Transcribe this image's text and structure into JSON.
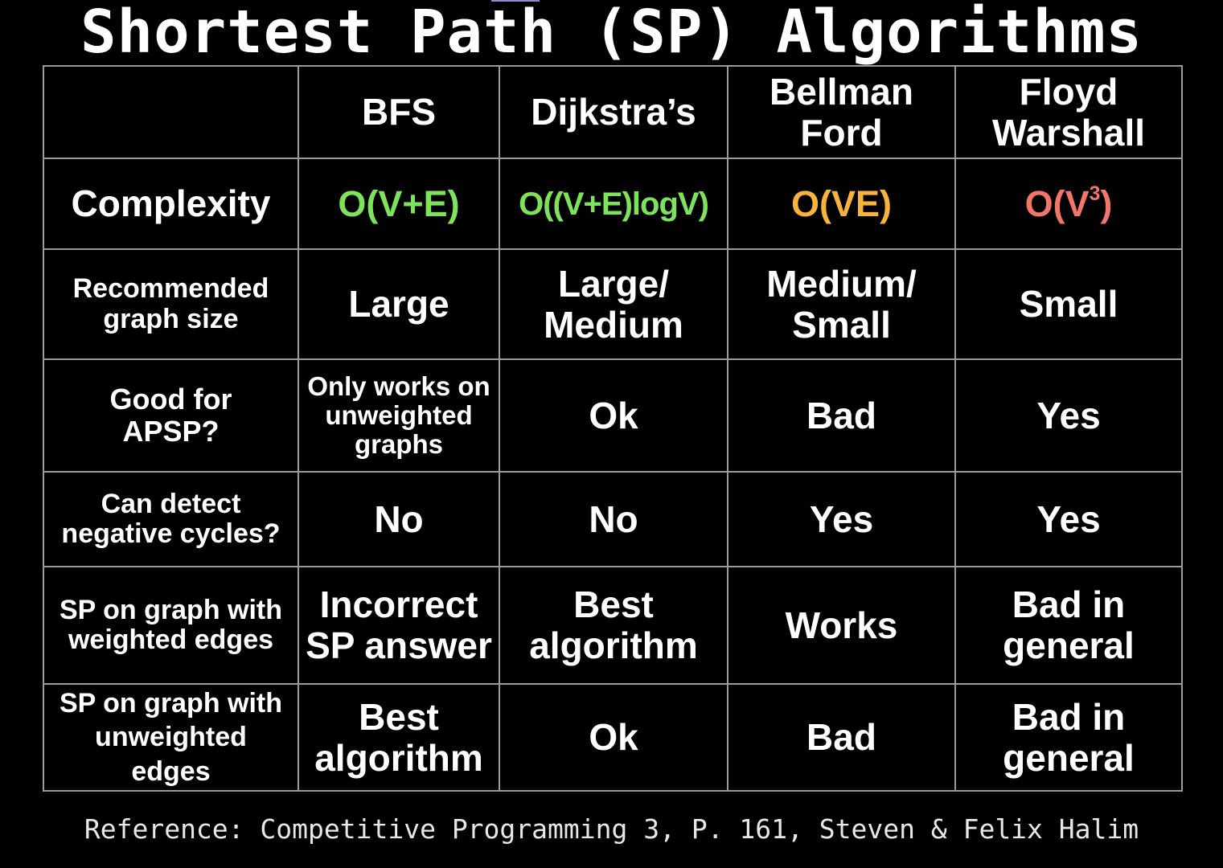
{
  "title": "Shortest Path (SP) Algorithms",
  "table": {
    "corner": "",
    "headers": [
      {
        "lines": [
          "BFS"
        ]
      },
      {
        "lines": [
          "Dijkstra’s"
        ]
      },
      {
        "lines": [
          "Bellman",
          "Ford"
        ]
      },
      {
        "lines": [
          "Floyd",
          "Warshall"
        ]
      }
    ],
    "complexity": {
      "label": "Complexity",
      "values": [
        {
          "text": "O(V+E)",
          "color": "#7de35a"
        },
        {
          "text": "O((V+E)logV)",
          "color": "#7de35a"
        },
        {
          "text": "O(VE)",
          "color": "#f9b33a"
        },
        {
          "base": "O(V",
          "sup": "3",
          "close": ")",
          "color": "#f2776a"
        }
      ]
    },
    "rows": [
      {
        "label": [
          "Recommended",
          "graph size"
        ],
        "cells": [
          [
            "Large"
          ],
          [
            "Large/",
            "Medium"
          ],
          [
            "Medium/",
            "Small"
          ],
          [
            "Small"
          ]
        ]
      },
      {
        "label": [
          "Good for",
          "APSP?"
        ],
        "cells": [
          [
            "Only works on",
            "unweighted",
            "graphs"
          ],
          [
            "Ok"
          ],
          [
            "Bad"
          ],
          [
            "Yes"
          ]
        ]
      },
      {
        "label": [
          "Can detect",
          "negative cycles?"
        ],
        "cells": [
          [
            "No"
          ],
          [
            "No"
          ],
          [
            "Yes"
          ],
          [
            "Yes"
          ]
        ]
      },
      {
        "label": [
          "SP on graph with",
          "weighted edges"
        ],
        "cells": [
          [
            "Incorrect",
            "SP answer"
          ],
          [
            "Best",
            "algorithm"
          ],
          [
            "Works"
          ],
          [
            "Bad in",
            "general"
          ]
        ]
      },
      {
        "label": [
          "SP on graph with",
          "unweighted",
          "edges"
        ],
        "cells": [
          [
            "Best",
            "algorithm"
          ],
          [
            "Ok"
          ],
          [
            "Bad"
          ],
          [
            "Bad in",
            "general"
          ]
        ]
      }
    ]
  },
  "footer": "Reference: Competitive Programming 3, P. 161, Steven & Felix Halim"
}
